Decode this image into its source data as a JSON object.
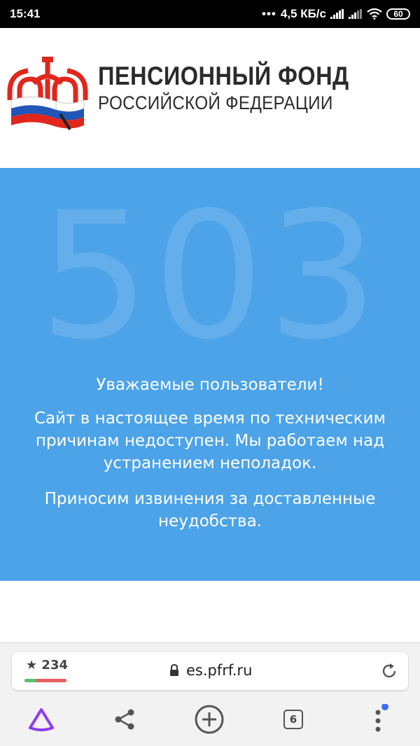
{
  "status_bar": {
    "time": "15:41",
    "network_speed": "4,5 КБ/с",
    "battery": "60",
    "icons": [
      "signal-icon",
      "signal-icon",
      "wifi-icon",
      "battery-icon"
    ]
  },
  "header": {
    "logo_icon": "pfr-logo-icon",
    "org_line1": "ПЕНСИОННЫЙ ФОНД",
    "org_line2": "РОССИЙСКОЙ ФЕДЕРАЦИИ"
  },
  "error": {
    "code": "503",
    "greeting": "Уважаемые пользователи!",
    "body": "Сайт в настоящее время по техническим причинам недоступен. Мы работаем над устранением неполадок.",
    "apology": "Приносим извинения за доставленные неудобства.",
    "panel_color": "#4ca3e8"
  },
  "browser": {
    "rating": "234",
    "rating_positive_fraction": 0.28,
    "url": "es.pfrf.ru",
    "tabs_count": "6",
    "icons": [
      "star-icon",
      "lock-icon",
      "reload-icon",
      "alice-icon",
      "share-icon",
      "add-tab-icon",
      "tabs-icon",
      "menu-icon"
    ]
  }
}
